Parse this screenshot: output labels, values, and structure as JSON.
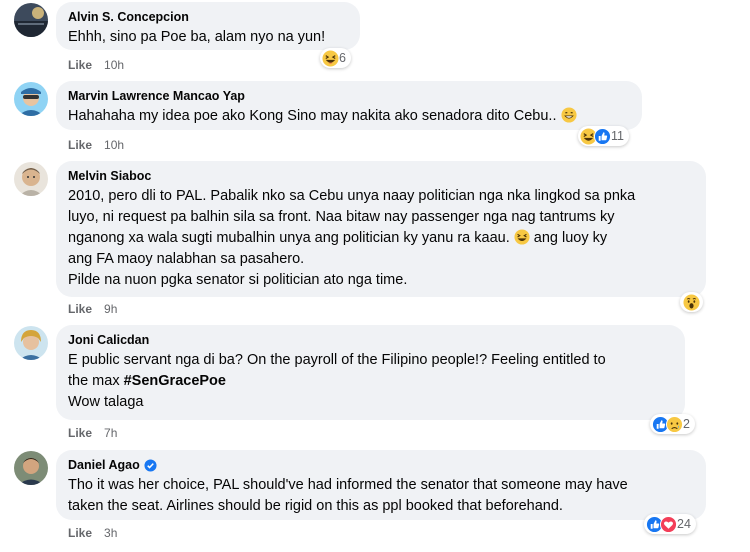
{
  "comments": [
    {
      "author": "Alvin S. Concepcion",
      "text": "Ehhh, sino pa Poe ba, alam nyo na yun!",
      "like_label": "Like",
      "time": "10h",
      "reactions": {
        "icons": [
          "haha-icon"
        ],
        "count": "6"
      }
    },
    {
      "author": "Marvin Lawrence Mancao Yap",
      "text": "Hahahaha my idea poe ako Kong Sino may nakita ako senadora dito Cebu..",
      "like_label": "Like",
      "time": "10h",
      "reactions": {
        "icons": [
          "haha-icon",
          "like-icon"
        ],
        "count": "11"
      }
    },
    {
      "author": "Melvin Siaboc",
      "lines": [
        "2010, pero dli to PAL. Pabalik nko sa Cebu unya naay politician nga nka lingkod sa pnka",
        "luyo, ni request pa balhin sila sa front. Naa bitaw nay passenger nga nag tantrums ky",
        "nganong xa wala sugti mubalhin unya ang politician ky yanu ra kaau.",
        " ang luoy ky",
        "ang FA maoy nalabhan sa pasahero.",
        "Pilde na nuon pgka senator si politician ato nga time."
      ],
      "like_label": "Like",
      "time": "9h",
      "reactions": {
        "icons": [
          "wow-icon"
        ],
        "count": ""
      }
    },
    {
      "author": "Joni Calicdan",
      "lines": [
        "E public servant nga di ba? On the payroll of the Filipino people!? Feeling entitled to",
        "the max ",
        "#SenGracePoe",
        "Wow talaga"
      ],
      "like_label": "Like",
      "time": "7h",
      "reactions": {
        "icons": [
          "like-icon",
          "sad-icon"
        ],
        "count": "2"
      }
    },
    {
      "author": "Daniel Agao",
      "lines": [
        "Tho it was her choice, PAL should've had informed the senator that someone may have",
        "taken the seat. Airlines should be rigid on this as ppl booked that beforehand."
      ],
      "like_label": "Like",
      "time": "3h",
      "reactions": {
        "icons": [
          "like-icon",
          "love-icon"
        ],
        "count": "24"
      }
    }
  ],
  "colors": {
    "bubble": "#f0f2f5",
    "like_blue": "#1877f2",
    "love_red": "#f33e58",
    "emoji_yellow": "#f7c843",
    "secondary_text": "#65676b"
  }
}
